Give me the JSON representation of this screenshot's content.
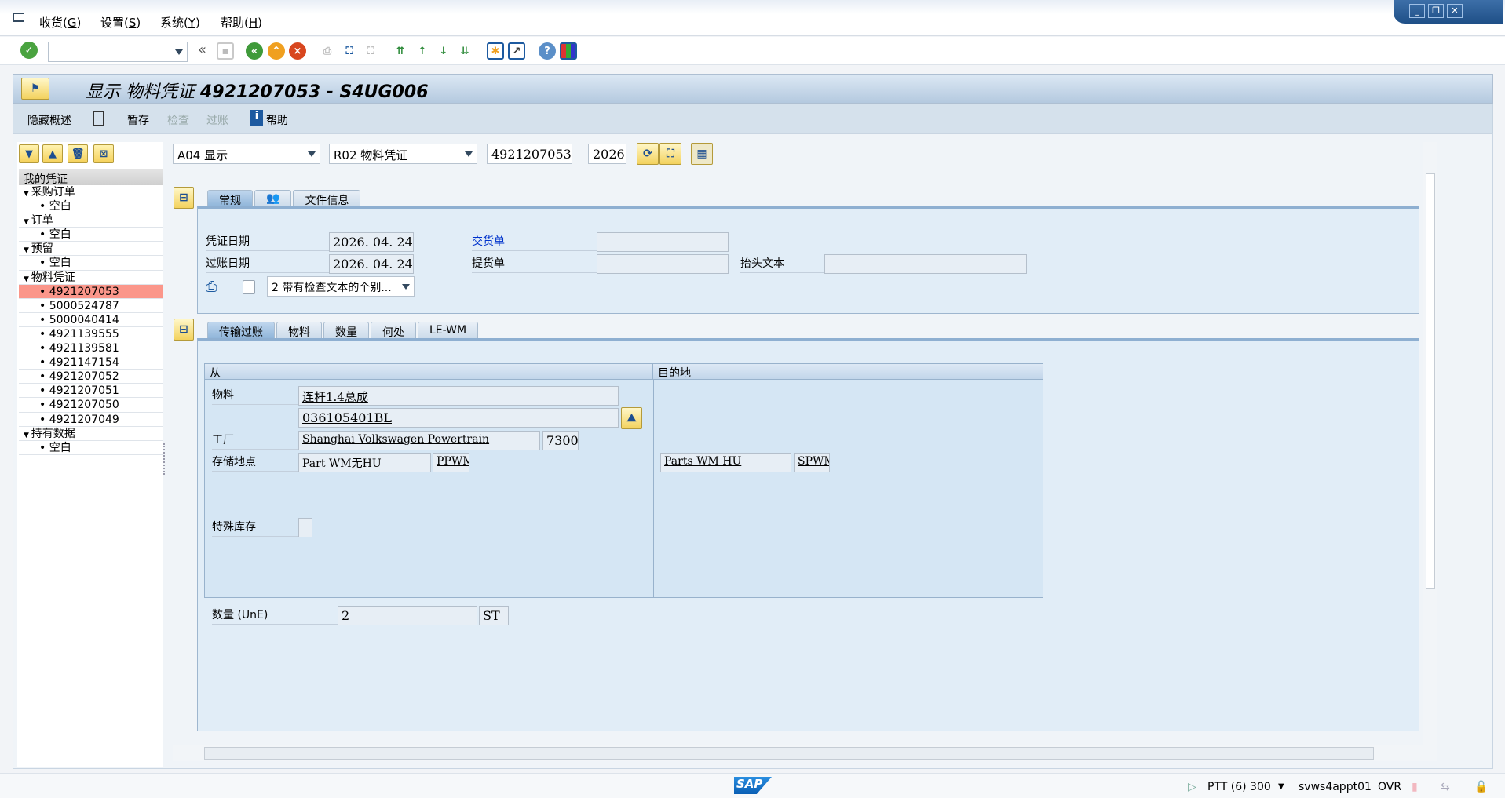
{
  "menu": [
    {
      "label": "收货",
      "key": "G"
    },
    {
      "label": "设置",
      "key": "S"
    },
    {
      "label": "系统",
      "key": "Y"
    },
    {
      "label": "帮助",
      "key": "H"
    }
  ],
  "toolbar": {
    "command_value": "",
    "icons": [
      "enter-icon",
      "save-icon",
      "back-icon",
      "exit-icon",
      "cancel-icon",
      "print-icon",
      "find-icon",
      "find-next-icon",
      "first-page-icon",
      "previous-page-icon",
      "next-page-icon",
      "last-page-icon",
      "new-session-icon",
      "shortcut-icon",
      "help-icon",
      "layout-icon"
    ]
  },
  "title": {
    "prefix": "显示 物料凭证",
    "doc": "4921207053 - S4UG006"
  },
  "app_toolbar": {
    "hide_overview": "隐藏概述",
    "hold": "暂存",
    "check": "检查",
    "post": "过账",
    "help": "帮助"
  },
  "tree": {
    "header": "我的凭证",
    "nodes": [
      {
        "label": "采购订单",
        "children": [
          "空白"
        ]
      },
      {
        "label": "订单",
        "children": [
          "空白"
        ]
      },
      {
        "label": "预留",
        "children": [
          "空白"
        ]
      },
      {
        "label": "物料凭证",
        "children": [
          "4921207053",
          "5000524787",
          "5000040414",
          "4921139555",
          "4921139581",
          "4921147154",
          "4921207052",
          "4921207051",
          "4921207050",
          "4921207049"
        ]
      },
      {
        "label": "持有数据",
        "children": [
          "空白"
        ]
      }
    ],
    "selected": "4921207053"
  },
  "controls": {
    "action": "A04 显示",
    "reference": "R02 物料凭证",
    "doc_number": "4921207053",
    "year": "2026"
  },
  "header_tabs": [
    "常规",
    "",
    "文件信息"
  ],
  "header": {
    "doc_date_label": "凭证日期",
    "doc_date": "2026. 04. 24",
    "post_date_label": "过账日期",
    "post_date": "2026. 04. 24",
    "delivery_note_label": "交货单",
    "delivery_note": "",
    "bill_of_lading_label": "提货单",
    "bill_of_lading": "",
    "header_text_label": "抬头文本",
    "header_text": "",
    "print_option": "2 带有检查文本的个别..."
  },
  "item_tabs": [
    "传输过账",
    "物料",
    "数量",
    "何处",
    "LE-WM"
  ],
  "item": {
    "from_label": "从",
    "to_label": "目的地",
    "material_label": "物料",
    "material_desc": "连杆1.4总成",
    "material_no": "036105401BL",
    "plant_label": "工厂",
    "plant_name": "Shanghai Volkswagen Powertrain",
    "plant_code": "7300",
    "sloc_label": "存储地点",
    "sloc_name": "Part WM无HU",
    "sloc_code": "PPWM",
    "dest_sloc_name": "Parts WM HU",
    "dest_sloc_code": "SPWM",
    "special_stock_label": "特殊库存",
    "qty_label": "数量 (UnE)",
    "qty": "2",
    "uom": "ST"
  },
  "status": {
    "system": "PTT (6) 300",
    "server": "svws4appt01",
    "mode": "OVR"
  },
  "colors": {
    "selected_row": "#fb968a",
    "link": "#0033cc"
  }
}
